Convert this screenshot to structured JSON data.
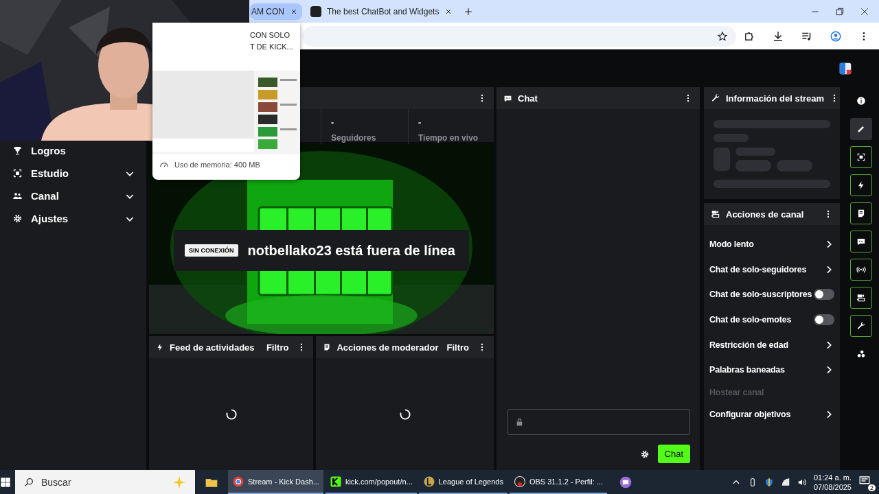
{
  "browser": {
    "tabs": [
      {
        "title": "AM CON",
        "selected": true
      },
      {
        "title": "The best ChatBot and Widgets",
        "selected": false
      }
    ]
  },
  "tab_preview": {
    "title_lines": [
      "CON SOLO",
      "T DE KICK..."
    ],
    "memory": "Uso de memoria: 400 MB"
  },
  "sidebar": {
    "items": [
      {
        "label": "Logros"
      },
      {
        "label": "Estudio",
        "expanded": false
      },
      {
        "label": "Canal",
        "expanded": false
      },
      {
        "label": "Ajustes",
        "expanded": false
      }
    ]
  },
  "stats": [
    {
      "value": "-",
      "label": "Seguidores"
    },
    {
      "value": "-",
      "label": "Tiempo en vivo"
    }
  ],
  "video": {
    "badge": "SIN CONEXIÓN",
    "message": "notbellako23 está fuera de línea"
  },
  "activity_feed": {
    "title": "Feed de actividades",
    "filter": "Filtro"
  },
  "mod_actions": {
    "title": "Acciones de moderador",
    "filter": "Filtro"
  },
  "chat": {
    "title": "Chat",
    "send": "Chat"
  },
  "stream_info": {
    "title": "Información del stream"
  },
  "channel_actions": {
    "title": "Acciones de canal",
    "items": [
      {
        "label": "Modo lento",
        "kind": "link"
      },
      {
        "label": "Chat de solo-seguidores",
        "kind": "link"
      },
      {
        "label": "Chat de solo-suscriptores",
        "kind": "toggle",
        "on": false
      },
      {
        "label": "Chat de solo-emotes",
        "kind": "toggle",
        "on": false
      },
      {
        "label": "Restricción de edad",
        "kind": "link"
      },
      {
        "label": "Palabras baneadas",
        "kind": "link"
      },
      {
        "label": "Hostear canal",
        "kind": "disabled"
      },
      {
        "label": "Configurar objetivos",
        "kind": "link"
      }
    ]
  },
  "rail": [
    {
      "selected": false,
      "outlined": false
    },
    {
      "selected": true,
      "outlined": false
    },
    {
      "selected": false,
      "outlined": true
    },
    {
      "selected": false,
      "outlined": true
    },
    {
      "selected": false,
      "outlined": true
    },
    {
      "selected": false,
      "outlined": true
    },
    {
      "selected": false,
      "outlined": true
    },
    {
      "selected": false,
      "outlined": true
    },
    {
      "selected": false,
      "outlined": true
    },
    {
      "selected": false,
      "outlined": false
    }
  ],
  "taskbar": {
    "search": "Buscar",
    "apps": [
      {
        "label": "Stream - Kick Dash...",
        "selected": true
      },
      {
        "label": "kick.com/popout/n...",
        "selected": false
      },
      {
        "label": "League of Legends",
        "selected": false
      },
      {
        "label": "OBS 31.1.2 - Perfil: ...",
        "selected": false
      }
    ],
    "time": "01:24 a. m.",
    "date": "07/08/2025",
    "notifications": "2"
  }
}
